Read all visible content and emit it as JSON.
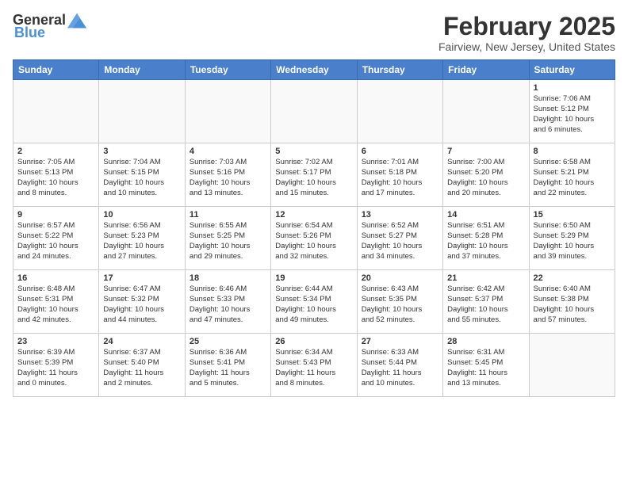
{
  "header": {
    "logo_general": "General",
    "logo_blue": "Blue",
    "month_year": "February 2025",
    "location": "Fairview, New Jersey, United States"
  },
  "days_of_week": [
    "Sunday",
    "Monday",
    "Tuesday",
    "Wednesday",
    "Thursday",
    "Friday",
    "Saturday"
  ],
  "weeks": [
    [
      {
        "day": "",
        "info": ""
      },
      {
        "day": "",
        "info": ""
      },
      {
        "day": "",
        "info": ""
      },
      {
        "day": "",
        "info": ""
      },
      {
        "day": "",
        "info": ""
      },
      {
        "day": "",
        "info": ""
      },
      {
        "day": "1",
        "info": "Sunrise: 7:06 AM\nSunset: 5:12 PM\nDaylight: 10 hours\nand 6 minutes."
      }
    ],
    [
      {
        "day": "2",
        "info": "Sunrise: 7:05 AM\nSunset: 5:13 PM\nDaylight: 10 hours\nand 8 minutes."
      },
      {
        "day": "3",
        "info": "Sunrise: 7:04 AM\nSunset: 5:15 PM\nDaylight: 10 hours\nand 10 minutes."
      },
      {
        "day": "4",
        "info": "Sunrise: 7:03 AM\nSunset: 5:16 PM\nDaylight: 10 hours\nand 13 minutes."
      },
      {
        "day": "5",
        "info": "Sunrise: 7:02 AM\nSunset: 5:17 PM\nDaylight: 10 hours\nand 15 minutes."
      },
      {
        "day": "6",
        "info": "Sunrise: 7:01 AM\nSunset: 5:18 PM\nDaylight: 10 hours\nand 17 minutes."
      },
      {
        "day": "7",
        "info": "Sunrise: 7:00 AM\nSunset: 5:20 PM\nDaylight: 10 hours\nand 20 minutes."
      },
      {
        "day": "8",
        "info": "Sunrise: 6:58 AM\nSunset: 5:21 PM\nDaylight: 10 hours\nand 22 minutes."
      }
    ],
    [
      {
        "day": "9",
        "info": "Sunrise: 6:57 AM\nSunset: 5:22 PM\nDaylight: 10 hours\nand 24 minutes."
      },
      {
        "day": "10",
        "info": "Sunrise: 6:56 AM\nSunset: 5:23 PM\nDaylight: 10 hours\nand 27 minutes."
      },
      {
        "day": "11",
        "info": "Sunrise: 6:55 AM\nSunset: 5:25 PM\nDaylight: 10 hours\nand 29 minutes."
      },
      {
        "day": "12",
        "info": "Sunrise: 6:54 AM\nSunset: 5:26 PM\nDaylight: 10 hours\nand 32 minutes."
      },
      {
        "day": "13",
        "info": "Sunrise: 6:52 AM\nSunset: 5:27 PM\nDaylight: 10 hours\nand 34 minutes."
      },
      {
        "day": "14",
        "info": "Sunrise: 6:51 AM\nSunset: 5:28 PM\nDaylight: 10 hours\nand 37 minutes."
      },
      {
        "day": "15",
        "info": "Sunrise: 6:50 AM\nSunset: 5:29 PM\nDaylight: 10 hours\nand 39 minutes."
      }
    ],
    [
      {
        "day": "16",
        "info": "Sunrise: 6:48 AM\nSunset: 5:31 PM\nDaylight: 10 hours\nand 42 minutes."
      },
      {
        "day": "17",
        "info": "Sunrise: 6:47 AM\nSunset: 5:32 PM\nDaylight: 10 hours\nand 44 minutes."
      },
      {
        "day": "18",
        "info": "Sunrise: 6:46 AM\nSunset: 5:33 PM\nDaylight: 10 hours\nand 47 minutes."
      },
      {
        "day": "19",
        "info": "Sunrise: 6:44 AM\nSunset: 5:34 PM\nDaylight: 10 hours\nand 49 minutes."
      },
      {
        "day": "20",
        "info": "Sunrise: 6:43 AM\nSunset: 5:35 PM\nDaylight: 10 hours\nand 52 minutes."
      },
      {
        "day": "21",
        "info": "Sunrise: 6:42 AM\nSunset: 5:37 PM\nDaylight: 10 hours\nand 55 minutes."
      },
      {
        "day": "22",
        "info": "Sunrise: 6:40 AM\nSunset: 5:38 PM\nDaylight: 10 hours\nand 57 minutes."
      }
    ],
    [
      {
        "day": "23",
        "info": "Sunrise: 6:39 AM\nSunset: 5:39 PM\nDaylight: 11 hours\nand 0 minutes."
      },
      {
        "day": "24",
        "info": "Sunrise: 6:37 AM\nSunset: 5:40 PM\nDaylight: 11 hours\nand 2 minutes."
      },
      {
        "day": "25",
        "info": "Sunrise: 6:36 AM\nSunset: 5:41 PM\nDaylight: 11 hours\nand 5 minutes."
      },
      {
        "day": "26",
        "info": "Sunrise: 6:34 AM\nSunset: 5:43 PM\nDaylight: 11 hours\nand 8 minutes."
      },
      {
        "day": "27",
        "info": "Sunrise: 6:33 AM\nSunset: 5:44 PM\nDaylight: 11 hours\nand 10 minutes."
      },
      {
        "day": "28",
        "info": "Sunrise: 6:31 AM\nSunset: 5:45 PM\nDaylight: 11 hours\nand 13 minutes."
      },
      {
        "day": "",
        "info": ""
      }
    ]
  ]
}
